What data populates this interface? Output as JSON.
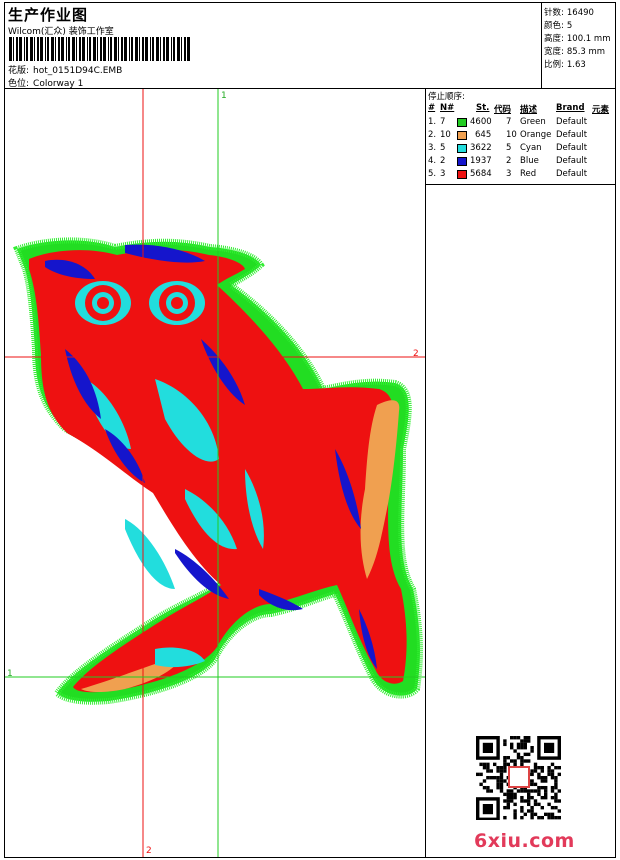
{
  "header": {
    "title": "生产作业图",
    "company": "Wilcom(汇众) 装饰工作室",
    "design_label": "花版:",
    "design_file": "hot_0151D94C.EMB",
    "colorway_label": "色位:",
    "colorway": "Colorway 1"
  },
  "stats": [
    {
      "label": "针数:",
      "value": "16490"
    },
    {
      "label": "颜色:",
      "value": "5"
    },
    {
      "label": "高度:",
      "value": "100.1 mm"
    },
    {
      "label": "宽度:",
      "value": "85.3 mm"
    },
    {
      "label": "比例:",
      "value": "1.63"
    }
  ],
  "stop_sequence": {
    "title": "停止顺序:",
    "headers": {
      "num": "#",
      "n": "N#",
      "st": "St.",
      "code": "代码",
      "desc": "描述",
      "brand": "Brand",
      "element": "元素"
    },
    "rows": [
      {
        "idx": "1.",
        "n": "7",
        "color": "#22cc22",
        "st": "4600",
        "code": "7",
        "desc": "Green",
        "brand": "Default"
      },
      {
        "idx": "2.",
        "n": "10",
        "color": "#f0a050",
        "st": "645",
        "code": "10",
        "desc": "Orange",
        "brand": "Default"
      },
      {
        "idx": "3.",
        "n": "5",
        "color": "#22dddd",
        "st": "3622",
        "code": "5",
        "desc": "Cyan",
        "brand": "Default"
      },
      {
        "idx": "4.",
        "n": "2",
        "color": "#1515cc",
        "st": "1937",
        "code": "2",
        "desc": "Blue",
        "brand": "Default"
      },
      {
        "idx": "5.",
        "n": "3",
        "color": "#ee1111",
        "st": "5684",
        "code": "3",
        "desc": "Red",
        "brand": "Default"
      }
    ]
  },
  "guides": {
    "v_label_top": "1",
    "h_label_right": "2",
    "h_label_left": "1",
    "v_label_bottom": "2"
  },
  "watermark": {
    "site": "6xiu.com"
  }
}
